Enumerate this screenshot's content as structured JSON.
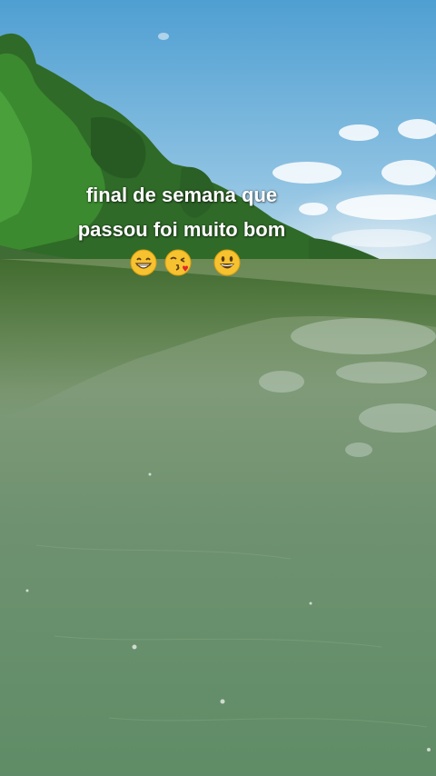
{
  "caption": {
    "line1": "final de semana que",
    "line2": "passou foi muito bom"
  },
  "emojis": [
    {
      "icon": "grinning-face-with-smiling-eyes-icon"
    },
    {
      "icon": "face-blowing-kiss-icon"
    },
    {
      "icon": "grinning-face-big-eyes-icon"
    }
  ],
  "colors": {
    "sky_top": "#5aa6d6",
    "sky_bottom": "#bcd9ea",
    "forest": "#2f6a28",
    "water_top": "#6e8f5f",
    "water_bottom": "#5e8a62",
    "emoji_yellow": "#f6c230"
  }
}
